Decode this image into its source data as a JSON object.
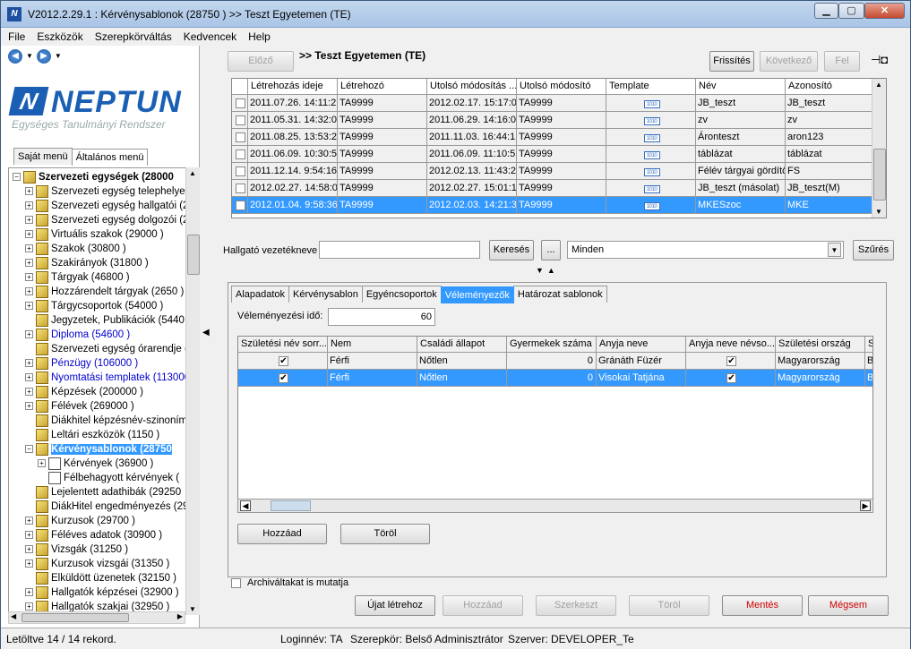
{
  "window": {
    "title": "V2012.2.29.1 : Kérvénysablonok (28750 ) >> Teszt Egyetemen (TE)",
    "app_icon": "N"
  },
  "menu": [
    "File",
    "Eszközök",
    "Szerepkörváltás",
    "Kedvencek",
    "Help"
  ],
  "logo": {
    "text": "NEPTUN",
    "mark": "N",
    "subtitle": "Egységes Tanulmányi Rendszer"
  },
  "left_tabs": [
    "Saját menü",
    "Általános menü"
  ],
  "tree": [
    {
      "label": "Szervezeti egységek (28000",
      "level": 0,
      "bold": true,
      "exp": "⊟"
    },
    {
      "label": "Szervezeti egység telephelyei",
      "level": 1,
      "exp": "+"
    },
    {
      "label": "Szervezeti egység hallgatói (2",
      "level": 1,
      "exp": "+"
    },
    {
      "label": "Szervezeti egység dolgozói (2",
      "level": 1,
      "exp": "+"
    },
    {
      "label": "Virtuális szakok (29000 )",
      "level": 1,
      "exp": "+"
    },
    {
      "label": "Szakok (30800 )",
      "level": 1,
      "exp": "+"
    },
    {
      "label": "Szakirányok (31800 )",
      "level": 1,
      "exp": "+"
    },
    {
      "label": "Tárgyak (46800 )",
      "level": 1,
      "exp": "+"
    },
    {
      "label": "Hozzárendelt tárgyak (2650 )",
      "level": 1,
      "exp": "+"
    },
    {
      "label": "Tárgycsoportok (54000 )",
      "level": 1,
      "exp": "+"
    },
    {
      "label": "Jegyzetek, Publikációk (5440",
      "level": 1,
      "exp": ""
    },
    {
      "label": "Diploma (54600 )",
      "level": 1,
      "exp": "+",
      "blue": true
    },
    {
      "label": "Szervezeti egység órarendje (",
      "level": 1,
      "exp": ""
    },
    {
      "label": "Pénzügy (106000 )",
      "level": 1,
      "exp": "+",
      "blue": true
    },
    {
      "label": "Nyomtatási templatek (113000",
      "level": 1,
      "exp": "+",
      "blue": true
    },
    {
      "label": "Képzések (200000 )",
      "level": 1,
      "exp": "+"
    },
    {
      "label": "Félévek (269000 )",
      "level": 1,
      "exp": "+"
    },
    {
      "label": "Diákhitel képzésnév-szinoním",
      "level": 1,
      "exp": ""
    },
    {
      "label": "Leltári eszközök (1150 )",
      "level": 1,
      "exp": ""
    },
    {
      "label": "Kérvénysablonok (28750",
      "level": 1,
      "exp": "⊟",
      "selected": true
    },
    {
      "label": "Kérvények (36900 )",
      "level": 2,
      "exp": "+",
      "doc": true
    },
    {
      "label": "Félbehagyott kérvények (",
      "level": 2,
      "exp": "",
      "doc": true
    },
    {
      "label": "Lejelentett adathibák (29250",
      "level": 1,
      "exp": ""
    },
    {
      "label": "DiákHitel engedményezés (29",
      "level": 1,
      "exp": ""
    },
    {
      "label": "Kurzusok (29700 )",
      "level": 1,
      "exp": "+"
    },
    {
      "label": "Féléves adatok (30900 )",
      "level": 1,
      "exp": "+"
    },
    {
      "label": "Vizsgák (31250 )",
      "level": 1,
      "exp": "+"
    },
    {
      "label": "Kurzusok vizsgái (31350 )",
      "level": 1,
      "exp": "+"
    },
    {
      "label": "Elküldött üzenetek (32150 )",
      "level": 1,
      "exp": ""
    },
    {
      "label": "Hallgatók képzései (32900 )",
      "level": 1,
      "exp": "+"
    },
    {
      "label": "Hallgatók szakjai (32950 )",
      "level": 1,
      "exp": "+"
    }
  ],
  "toolbar": {
    "prev": "Előző",
    "breadcrumb": ">> Teszt Egyetemen (TE)",
    "refresh": "Frissítés",
    "next": "Következő",
    "up": "Fel",
    "pin_icon": "pin-icon"
  },
  "main_grid": {
    "headers": [
      "",
      "Létrehozás ideje",
      "Létrehozó",
      "Utolsó módosítás ...",
      "Utolsó módosító",
      "Template",
      "Név",
      "Azonosító"
    ],
    "rows": [
      [
        "2011.07.26. 14:11:2",
        "TA9999",
        "2012.02.17. 15:17:0",
        "TA9999",
        "JB_teszt",
        "JB_teszt"
      ],
      [
        "2011.05.31. 14:32:0",
        "TA9999",
        "2011.06.29. 14:16:0",
        "TA9999",
        "zv",
        "zv"
      ],
      [
        "2011.08.25. 13:53:2",
        "TA9999",
        "2011.11.03. 16:44:1",
        "TA9999",
        "Áronteszt",
        "aron123"
      ],
      [
        "2011.06.09. 10:30:5",
        "TA9999",
        "2011.06.09. 11:10:5",
        "TA9999",
        "táblázat",
        "táblázat"
      ],
      [
        "2011.12.14. 9:54:16",
        "TA9999",
        "2012.02.13. 11:43:2",
        "TA9999",
        "Félév tárgyai gördítő",
        "FS"
      ],
      [
        "2012.02.27. 14:58:0",
        "TA9999",
        "2012.02.27. 15:01:1",
        "TA9999",
        "JB_teszt (másolat)",
        "JB_teszt(M)"
      ],
      [
        "2012.01.04. 9:58:36",
        "TA9999",
        "2012.02.03. 14:21:3",
        "TA9999",
        "MKESzoc",
        "MKE"
      ]
    ],
    "selected_row": 6
  },
  "search": {
    "label": "Hallgató vezetékneve",
    "value": "",
    "button": "Keresés",
    "ellipsis": "...",
    "dropdown": "Minden",
    "filter": "Szűrés"
  },
  "detail_tabs": [
    "Alapadatok",
    "Kérvénysablon",
    "Egyéncsoportok",
    "Véleményezők",
    "Határozat sablonok"
  ],
  "detail_active_tab": 3,
  "opinion_time": {
    "label": "Véleményezési idő:",
    "value": "60"
  },
  "detail_grid": {
    "headers": [
      "Születési név sorr...",
      "Nem",
      "Családi állapot",
      "Gyermekek száma",
      "Anyja neve",
      "Anyja neve névso...",
      "Születési ország",
      "S"
    ],
    "rows": [
      [
        "✔",
        "Férfi",
        "Nőtlen",
        "0",
        "Gránáth Füzér",
        "✔",
        "Magyarország",
        "B"
      ],
      [
        "✔",
        "Férfi",
        "Nőtlen",
        "0",
        "Visokai Tatjána",
        "✔",
        "Magyarország",
        "B"
      ]
    ],
    "selected_row": 1
  },
  "detail_buttons": {
    "add": "Hozzáad",
    "delete": "Töröl"
  },
  "archived_label": "Archiváltakat is mutatja",
  "bottom_buttons": {
    "new": "Újat létrehoz",
    "add": "Hozzáad",
    "edit": "Szerkeszt",
    "delete": "Töröl",
    "save": "Mentés",
    "cancel": "Mégsem"
  },
  "status": {
    "loaded": "Letöltve 14 / 14 rekord.",
    "login": "Loginnév: TA",
    "role": "Szerepkör: Belső Adminisztrátor",
    "server": "Szerver: DEVELOPER_Te"
  },
  "colors": {
    "selection": "#3399ff",
    "brand": "#1a5fb4",
    "danger": "#d00000"
  }
}
